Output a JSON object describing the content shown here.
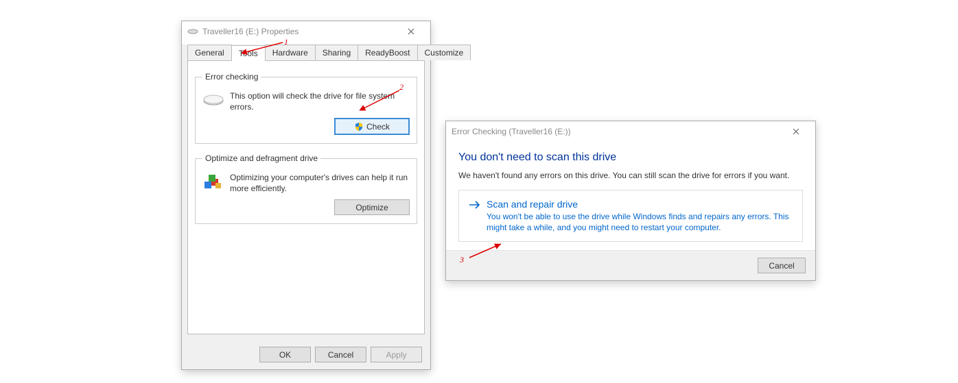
{
  "properties": {
    "title": "Traveller16 (E:) Properties",
    "tabs": [
      "General",
      "Tools",
      "Hardware",
      "Sharing",
      "ReadyBoost",
      "Customize"
    ],
    "active_tab_index": 1,
    "error_checking": {
      "legend": "Error checking",
      "text": "This option will check the drive for file system errors.",
      "button": "Check"
    },
    "optimize": {
      "legend": "Optimize and defragment drive",
      "text": "Optimizing your computer's drives can help it run more efficiently.",
      "button": "Optimize"
    },
    "buttons": {
      "ok": "OK",
      "cancel": "Cancel",
      "apply": "Apply"
    }
  },
  "error_dialog": {
    "title": "Error Checking (Traveller16 (E:))",
    "heading": "You don't need to scan this drive",
    "body": "We haven't found any errors on this drive. You can still scan the drive for errors if you want.",
    "option": {
      "label": "Scan and repair drive",
      "desc": "You won't be able to use the drive while Windows finds and repairs any errors. This might take a while, and you might need to restart your computer."
    },
    "cancel": "Cancel"
  },
  "annotations": {
    "a1": "1",
    "a2": "2",
    "a3": "3"
  }
}
